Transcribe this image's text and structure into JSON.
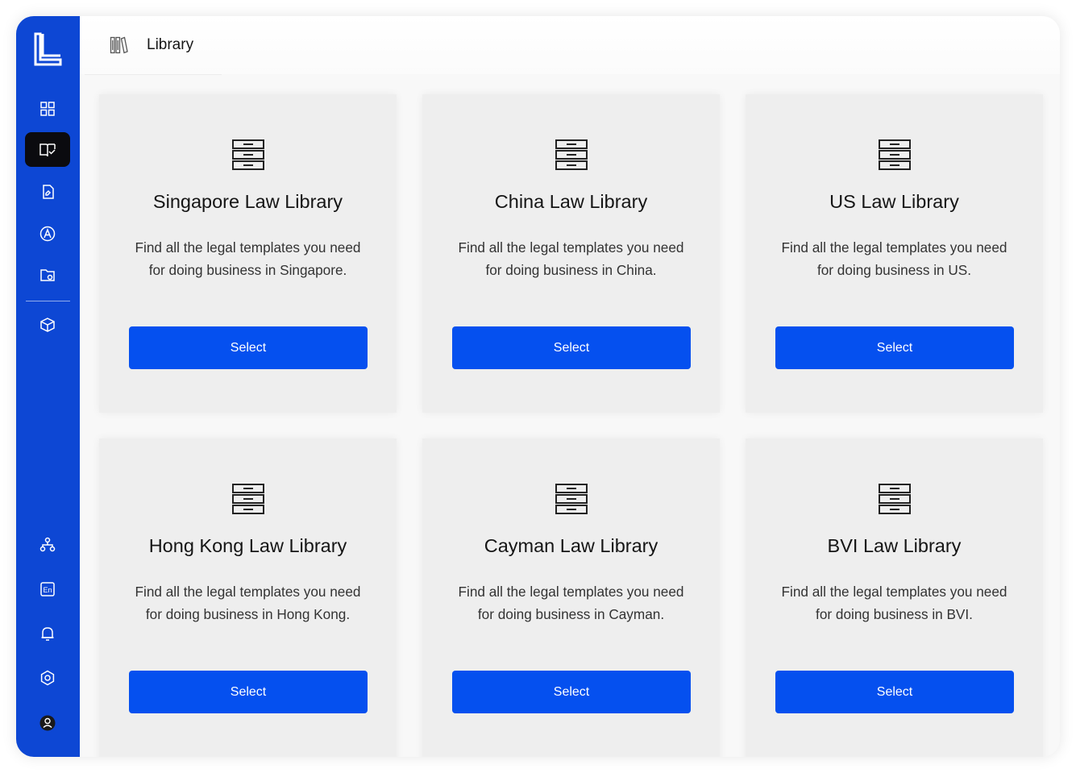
{
  "header": {
    "title": "Library"
  },
  "colors": {
    "sidebar": "#0d47d4",
    "accent_button": "#0550ef",
    "active_nav": "#0b0b0f"
  },
  "sidebar": {
    "logo": "L-logo",
    "items": [
      {
        "icon": "dashboard-grid-icon",
        "active": false
      },
      {
        "icon": "book-library-icon",
        "active": true
      },
      {
        "icon": "document-edit-icon",
        "active": false
      },
      {
        "icon": "signature-icon",
        "active": false
      },
      {
        "icon": "folder-icon",
        "active": false
      },
      {
        "icon": "cube-icon",
        "active": false
      }
    ],
    "bottom_items": [
      {
        "icon": "org-chart-icon"
      },
      {
        "icon": "language-en-icon",
        "label": "En"
      },
      {
        "icon": "bell-icon"
      },
      {
        "icon": "gear-icon"
      },
      {
        "icon": "user-avatar-icon"
      }
    ]
  },
  "libraries": [
    {
      "title": "Singapore Law Library",
      "description": "Find all the legal templates you need for doing business in Singapore.",
      "button": "Select"
    },
    {
      "title": "China Law Library",
      "description": "Find all the legal templates you need for doing business in China.",
      "button": "Select"
    },
    {
      "title": "US Law Library",
      "description": "Find all the legal templates you need for doing business in US.",
      "button": "Select"
    },
    {
      "title": "Hong Kong Law Library",
      "description": "Find all the legal templates you need for doing business in Hong Kong.",
      "button": "Select"
    },
    {
      "title": "Cayman Law Library",
      "description": "Find all the legal templates you need for doing business in Cayman.",
      "button": "Select"
    },
    {
      "title": "BVI Law Library",
      "description": "Find all the legal templates you need for doing business in BVI.",
      "button": "Select"
    }
  ]
}
